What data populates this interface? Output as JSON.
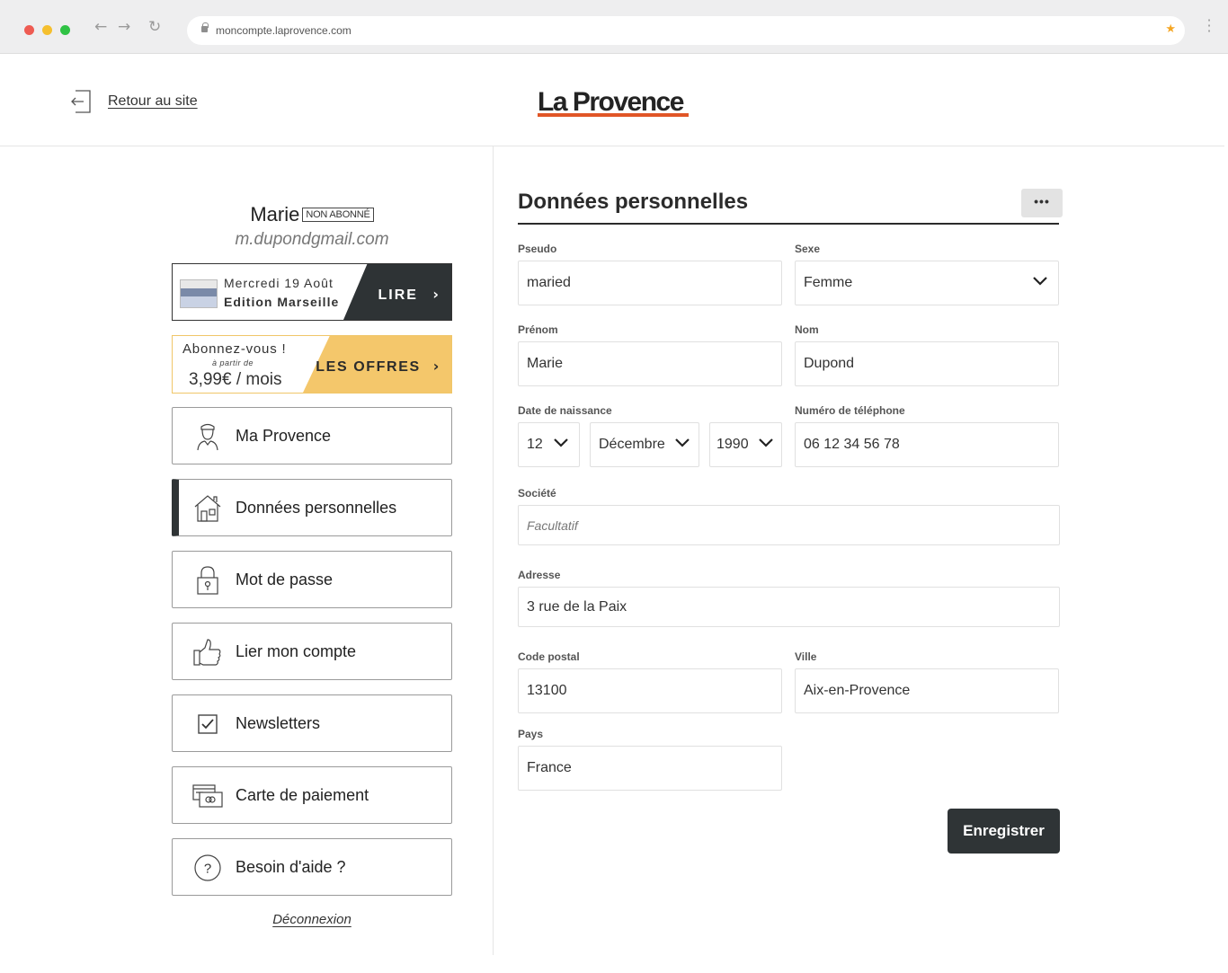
{
  "browser": {
    "url": "moncompte.laprovence.com"
  },
  "header": {
    "back_label": "Retour au site",
    "logo_text": "La Provence",
    "logo_accent_color": "#e15627"
  },
  "profile": {
    "first_name": "Marie",
    "status_badge": "NON ABONNÉ",
    "email": "m.dupondgmail.com"
  },
  "read_card": {
    "date": "Mercredi 19 Août",
    "edition": "Edition Marseille",
    "cta": "LIRE",
    "bg_color": "#2e3335"
  },
  "offer_card": {
    "line1": "Abonnez-vous !",
    "line2": "à partir de",
    "price": "3,99€ / mois",
    "cta": "LES OFFRES",
    "accent_color": "#f4c76b"
  },
  "sidebar": {
    "items": [
      {
        "label": "Ma Provence",
        "icon": "user-icon",
        "active": false
      },
      {
        "label": "Données personnelles",
        "icon": "house-icon",
        "active": true
      },
      {
        "label": "Mot de passe",
        "icon": "lock-icon",
        "active": false
      },
      {
        "label": "Lier mon compte",
        "icon": "thumbs-up-icon",
        "active": false
      },
      {
        "label": "Newsletters",
        "icon": "checkbox-icon",
        "active": false
      },
      {
        "label": "Carte de paiement",
        "icon": "card-icon",
        "active": false
      },
      {
        "label": "Besoin d'aide ?",
        "icon": "question-icon",
        "active": false
      }
    ],
    "logout_label": "Déconnexion"
  },
  "form": {
    "title": "Données personnelles",
    "more_button": "•••",
    "pseudo": {
      "label": "Pseudo",
      "value": "maried"
    },
    "sexe": {
      "label": "Sexe",
      "value": "Femme"
    },
    "prenom": {
      "label": "Prénom",
      "value": "Marie"
    },
    "nom": {
      "label": "Nom",
      "value": "Dupond"
    },
    "birth": {
      "label": "Date de naissance",
      "day": "12",
      "month": "Décembre",
      "year": "1990"
    },
    "phone": {
      "label": "Numéro de téléphone",
      "value": "06 12 34 56 78"
    },
    "societe": {
      "label": "Société",
      "placeholder": "Facultatif"
    },
    "adresse": {
      "label": "Adresse",
      "value": "3 rue de la Paix"
    },
    "code_postal": {
      "label": "Code postal",
      "value": "13100"
    },
    "ville": {
      "label": "Ville",
      "value": "Aix-en-Provence"
    },
    "pays": {
      "label": "Pays",
      "value": "France"
    },
    "submit_label": "Enregistrer",
    "submit_color": "#2f3436"
  }
}
